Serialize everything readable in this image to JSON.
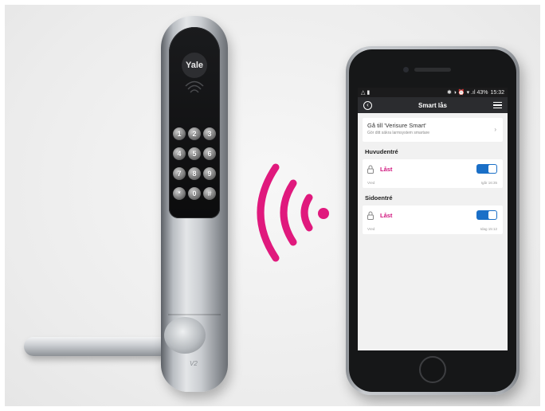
{
  "lock": {
    "logo_text": "Yale",
    "keys": [
      "1",
      "2",
      "3",
      "4",
      "5",
      "6",
      "7",
      "8",
      "9",
      "*",
      "0",
      "#"
    ],
    "model_mark": "V2"
  },
  "phone": {
    "status_bar": {
      "left": "△ ▮",
      "right": "✱ ◑ ⏰ ▾ .ıl 43%",
      "time": "15:32"
    },
    "app_bar": {
      "title": "Smart lås"
    },
    "promo": {
      "title": "Gå till 'Verisure Smart'",
      "subtitle": "Gör ditt säkra larmsystem smartare"
    },
    "sections": [
      {
        "heading": "Huvudentré",
        "status": "Låst",
        "toggle_on": true,
        "label": "Vred",
        "time": "Igår 16:35"
      },
      {
        "heading": "Sidoentré",
        "status": "Låst",
        "toggle_on": true,
        "label": "Vred",
        "time": "Idag 15:12"
      }
    ]
  },
  "colors": {
    "signal_waves": "#e0197d",
    "locked_text": "#d0157d",
    "toggle": "#1a6fc7",
    "app_bar": "#2b2c2f"
  },
  "icons": [
    "nfc-icon",
    "back-arrow-icon",
    "hamburger-menu-icon",
    "chevron-right-icon",
    "padlock-icon",
    "wireless-signal-icon"
  ]
}
